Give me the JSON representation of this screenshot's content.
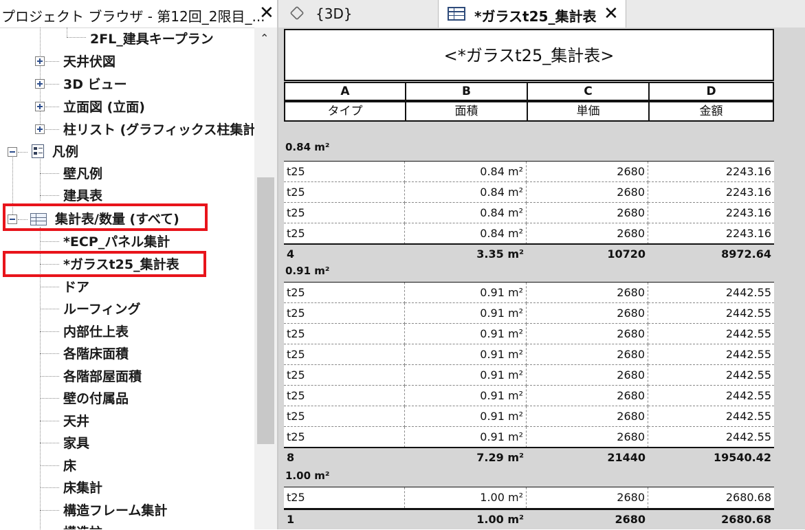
{
  "browser": {
    "title": "プロジェクト ブラウザ - 第12回_2限目_...",
    "close": "✕",
    "items": [
      {
        "label": "2FL_建具キープラン"
      },
      {
        "label": "天井伏図"
      },
      {
        "label": "3D ビュー"
      },
      {
        "label": "立面図 (立面)"
      },
      {
        "label": "柱リスト (グラフィックス柱集計)"
      },
      {
        "label": "凡例"
      },
      {
        "label": "壁凡例"
      },
      {
        "label": "建具表"
      },
      {
        "label": "集計表/数量 (すべて)"
      },
      {
        "label": "*ECP_パネル集計"
      },
      {
        "label": "*ガラスt25_集計表"
      },
      {
        "label": "ドア"
      },
      {
        "label": "ルーフィング"
      },
      {
        "label": "内部仕上表"
      },
      {
        "label": "各階床面積"
      },
      {
        "label": "各階部屋面積"
      },
      {
        "label": "壁の付属品"
      },
      {
        "label": "天井"
      },
      {
        "label": "家具"
      },
      {
        "label": "床"
      },
      {
        "label": "床集計"
      },
      {
        "label": "構造フレーム集計"
      },
      {
        "label": "構造柱"
      }
    ],
    "scroll_up": "⌃"
  },
  "tabs": {
    "tab_3d": "{3D}",
    "tab_schedule": "*ガラスt25_集計表",
    "close": "✕"
  },
  "schedule": {
    "title": "<*ガラスt25_集計表>",
    "col_letters": [
      "A",
      "B",
      "C",
      "D"
    ],
    "col_names": [
      "タイプ",
      "面積",
      "単価",
      "金額"
    ],
    "groups": [
      {
        "header": "0.84 m²",
        "rows": [
          [
            "t25",
            "0.84 m²",
            "2680",
            "2243.16"
          ],
          [
            "t25",
            "0.84 m²",
            "2680",
            "2243.16"
          ],
          [
            "t25",
            "0.84 m²",
            "2680",
            "2243.16"
          ],
          [
            "t25",
            "0.84 m²",
            "2680",
            "2243.16"
          ]
        ],
        "total": [
          "4",
          "3.35 m²",
          "10720",
          "8972.64"
        ]
      },
      {
        "header": "0.91 m²",
        "rows": [
          [
            "t25",
            "0.91 m²",
            "2680",
            "2442.55"
          ],
          [
            "t25",
            "0.91 m²",
            "2680",
            "2442.55"
          ],
          [
            "t25",
            "0.91 m²",
            "2680",
            "2442.55"
          ],
          [
            "t25",
            "0.91 m²",
            "2680",
            "2442.55"
          ],
          [
            "t25",
            "0.91 m²",
            "2680",
            "2442.55"
          ],
          [
            "t25",
            "0.91 m²",
            "2680",
            "2442.55"
          ],
          [
            "t25",
            "0.91 m²",
            "2680",
            "2442.55"
          ],
          [
            "t25",
            "0.91 m²",
            "2680",
            "2442.55"
          ]
        ],
        "total": [
          "8",
          "7.29 m²",
          "21440",
          "19540.42"
        ]
      },
      {
        "header": "1.00 m²",
        "rows": [
          [
            "t25",
            "1.00 m²",
            "2680",
            "2680.68"
          ]
        ],
        "total": [
          "1",
          "1.00 m²",
          "2680",
          "2680.68"
        ]
      }
    ]
  },
  "colors": {
    "highlight": "#e8141b",
    "view_bg": "#d6d6d6",
    "tree_icon": "#2c4d8c"
  }
}
